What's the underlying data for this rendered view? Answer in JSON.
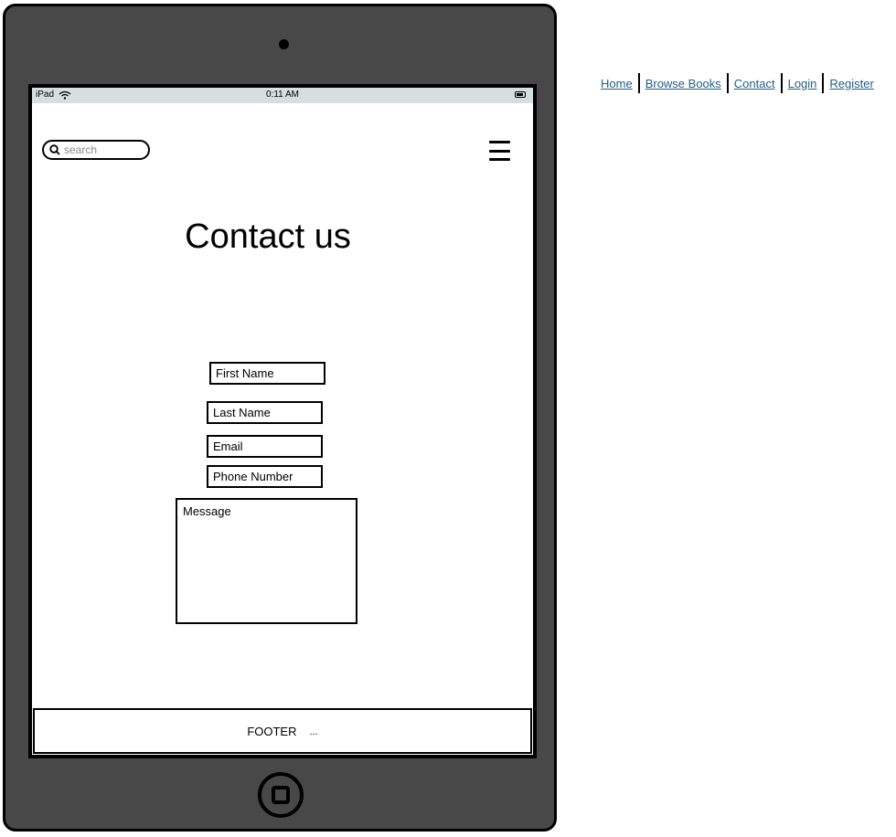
{
  "status_bar": {
    "device_label": "iPad",
    "time": "0:11 AM"
  },
  "search": {
    "placeholder": "search"
  },
  "page": {
    "title": "Contact us"
  },
  "form": {
    "first_name_placeholder": "First Name",
    "last_name_placeholder": "Last Name",
    "email_placeholder": "Email",
    "phone_placeholder": "Phone Number",
    "message_placeholder": "Message"
  },
  "footer": {
    "label": "FOOTER",
    "ellipsis": "..."
  },
  "nav": {
    "items": [
      {
        "label": "Home"
      },
      {
        "label": "Browse Books"
      },
      {
        "label": "Contact"
      },
      {
        "label": "Login"
      },
      {
        "label": "Register"
      }
    ]
  },
  "icons": {
    "search": "magnifier",
    "menu": "hamburger",
    "wifi": "wifi",
    "battery": "battery"
  },
  "colors": {
    "device_frame": "#484848",
    "status_bar": "#d8dde0",
    "link": "#1f5f8b"
  }
}
